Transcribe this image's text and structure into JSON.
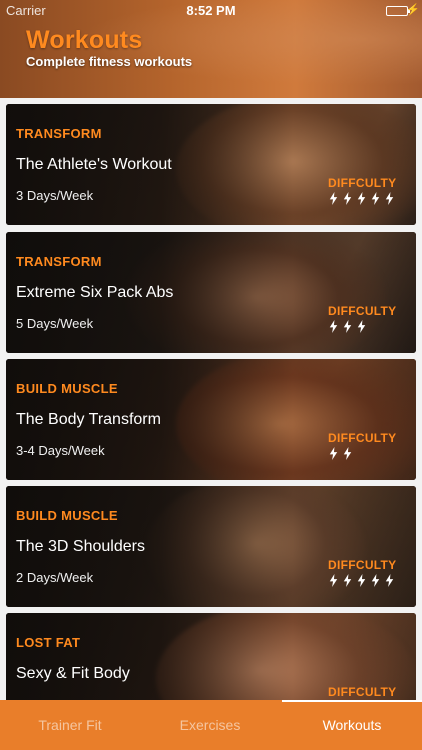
{
  "status_bar": {
    "carrier": "Carrier",
    "time": "8:52 PM",
    "battery_level": 1.0,
    "charging_icon": "charge-icon"
  },
  "header": {
    "title": "Workouts",
    "subtitle": "Complete fitness workouts"
  },
  "workouts": [
    {
      "category": "TRANSFORM",
      "name": "The Athlete's Workout",
      "frequency": "3 Days/Week",
      "difficulty_label": "DIFFCULTY",
      "difficulty": 5
    },
    {
      "category": "TRANSFORM",
      "name": "Extreme Six Pack Abs",
      "frequency": "5 Days/Week",
      "difficulty_label": "DIFFCULTY",
      "difficulty": 3
    },
    {
      "category": "BUILD MUSCLE",
      "name": "The Body Transform",
      "frequency": "3-4 Days/Week",
      "difficulty_label": "DIFFCULTY",
      "difficulty": 2
    },
    {
      "category": "BUILD MUSCLE",
      "name": "The 3D Shoulders",
      "frequency": "2 Days/Week",
      "difficulty_label": "DIFFCULTY",
      "difficulty": 5
    },
    {
      "category": "LOST FAT",
      "name": "Sexy & Fit Body",
      "frequency": "",
      "difficulty_label": "DIFFCULTY",
      "difficulty": 0
    }
  ],
  "tabbar": {
    "tabs": [
      {
        "label": "Trainer Fit",
        "active": false
      },
      {
        "label": "Exercises",
        "active": false
      },
      {
        "label": "Workouts",
        "active": true
      }
    ]
  },
  "colors": {
    "accent": "#ff8a1f",
    "tabbar": "#e97e2a",
    "card_dark": "#1a1512"
  },
  "icons": {
    "difficulty": "lightning-bolt-icon"
  }
}
